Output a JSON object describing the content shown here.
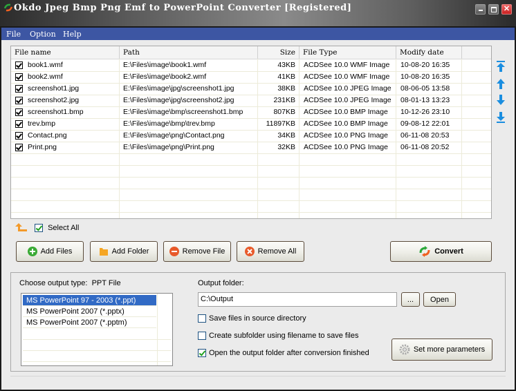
{
  "window": {
    "title": "Okdo Jpeg Bmp Png Emf to PowerPoint Converter [Registered]",
    "controls": [
      "minimize",
      "maximize",
      "close"
    ]
  },
  "menu": {
    "items": [
      {
        "label": "File"
      },
      {
        "label": "Option"
      },
      {
        "label": "Help"
      }
    ]
  },
  "file_list": {
    "columns": [
      "File name",
      "Path",
      "Size",
      "File Type",
      "Modify date"
    ],
    "rows": [
      {
        "checked": true,
        "name": "book1.wmf",
        "path": "E:\\Files\\image\\book1.wmf",
        "size": "43KB",
        "type": "ACDSee 10.0 WMF Image",
        "date": "10-08-20 16:35"
      },
      {
        "checked": true,
        "name": "book2.wmf",
        "path": "E:\\Files\\image\\book2.wmf",
        "size": "41KB",
        "type": "ACDSee 10.0 WMF Image",
        "date": "10-08-20 16:35"
      },
      {
        "checked": true,
        "name": "screenshot1.jpg",
        "path": "E:\\Files\\image\\jpg\\screenshot1.jpg",
        "size": "38KB",
        "type": "ACDSee 10.0 JPEG Image",
        "date": "08-06-05 13:58"
      },
      {
        "checked": true,
        "name": "screenshot2.jpg",
        "path": "E:\\Files\\image\\jpg\\screenshot2.jpg",
        "size": "231KB",
        "type": "ACDSee 10.0 JPEG Image",
        "date": "08-01-13 13:23"
      },
      {
        "checked": true,
        "name": "screenshot1.bmp",
        "path": "E:\\Files\\image\\bmp\\screenshot1.bmp",
        "size": "807KB",
        "type": "ACDSee 10.0 BMP Image",
        "date": "10-12-26 23:10"
      },
      {
        "checked": true,
        "name": "trev.bmp",
        "path": "E:\\Files\\image\\bmp\\trev.bmp",
        "size": "11897KB",
        "type": "ACDSee 10.0 BMP Image",
        "date": "09-08-12 22:01"
      },
      {
        "checked": true,
        "name": "Contact.png",
        "path": "E:\\Files\\image\\png\\Contact.png",
        "size": "34KB",
        "type": "ACDSee 10.0 PNG Image",
        "date": "06-11-08 20:53"
      },
      {
        "checked": true,
        "name": "Print.png",
        "path": "E:\\Files\\image\\png\\Print.png",
        "size": "32KB",
        "type": "ACDSee 10.0 PNG Image",
        "date": "06-11-08 20:52"
      }
    ]
  },
  "side_arrows": [
    "move-top",
    "move-up",
    "move-down",
    "move-bottom"
  ],
  "select_all": {
    "label": "Select All",
    "checked": true
  },
  "buttons": {
    "add_files": "Add Files",
    "add_folder": "Add Folder",
    "remove_file": "Remove File",
    "remove_all": "Remove All",
    "convert": "Convert"
  },
  "output": {
    "type_label": "Choose output type:",
    "type_value": "PPT File",
    "types": [
      {
        "label": "MS PowerPoint 97 - 2003 (*.ppt)",
        "selected": true
      },
      {
        "label": "MS PowerPoint 2007 (*.pptx)",
        "selected": false
      },
      {
        "label": "MS PowerPoint 2007 (*.pptm)",
        "selected": false
      }
    ],
    "folder_label": "Output folder:",
    "folder_value": "C:\\Output",
    "browse_label": "...",
    "open_label": "Open",
    "options": [
      {
        "label": "Save files in source directory",
        "checked": false
      },
      {
        "label": "Create subfolder using filename to save files",
        "checked": false
      },
      {
        "label": "Open the output folder after conversion finished",
        "checked": true
      }
    ],
    "more_params_label": "Set more parameters"
  },
  "colors": {
    "menubar": "#3d56a3",
    "selection": "#316ac5",
    "check_green": "#21a121",
    "arrow_blue": "#1a8ee0",
    "up_orange": "#f39a2a"
  }
}
